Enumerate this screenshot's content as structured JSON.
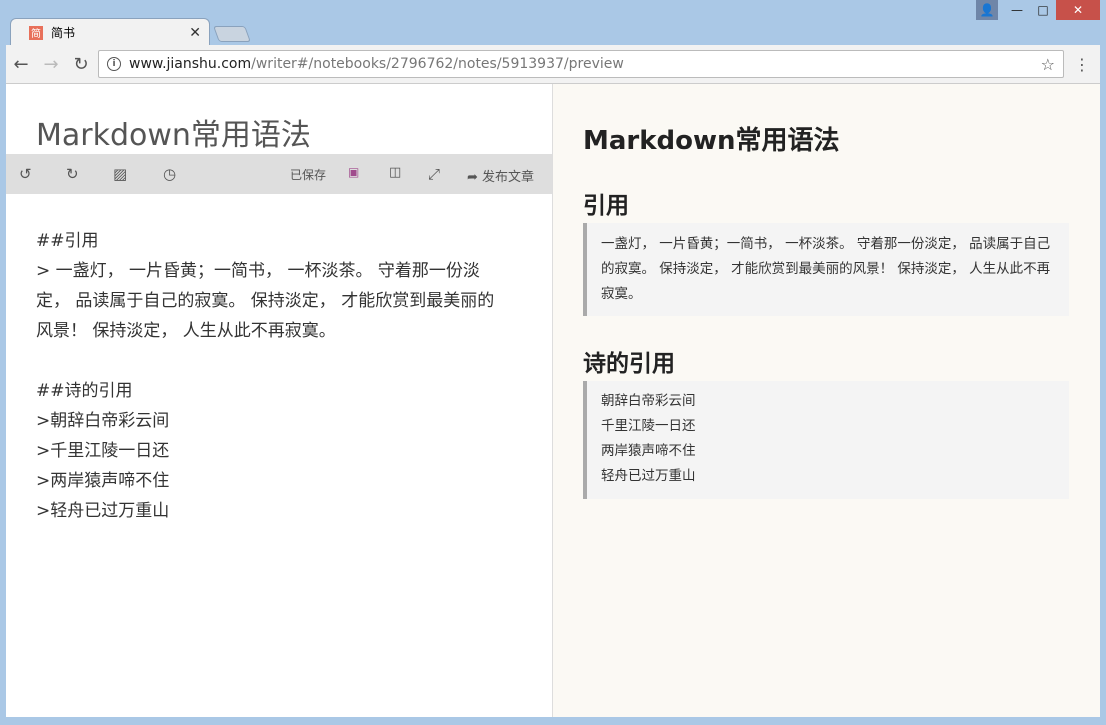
{
  "browser": {
    "tab_title": "简书",
    "favicon_text": "简",
    "url_host": "www.jianshu.com",
    "url_path": "/writer#/notebooks/2796762/notes/5913937/preview"
  },
  "editor": {
    "title": "Markdown常用语法",
    "toolbar": {
      "saved_label": "已保存",
      "publish_label": "发布文章"
    },
    "lines": [
      "##引用",
      "> 一盏灯， 一片昏黄；一简书， 一杯淡茶。 守着那一份淡",
      "定， 品读属于自己的寂寞。 保持淡定， 才能欣赏到最美丽的",
      "风景！ 保持淡定， 人生从此不再寂寞。",
      "",
      "##诗的引用",
      ">朝辞白帝彩云间",
      ">千里江陵一日还",
      ">两岸猿声啼不住",
      ">轻舟已过万重山"
    ]
  },
  "preview": {
    "title": "Markdown常用语法",
    "h2_1": "引用",
    "quote1": "一盏灯， 一片昏黄；一简书， 一杯淡茶。 守着那一份淡定， 品读属于自己的寂寞。 保持淡定， 才能欣赏到最美丽的风景！ 保持淡定， 人生从此不再寂寞。",
    "h2_2": "诗的引用",
    "poem": [
      "朝辞白帝彩云间",
      "千里江陵一日还",
      "两岸猿声啼不住",
      "轻舟已过万重山"
    ]
  }
}
